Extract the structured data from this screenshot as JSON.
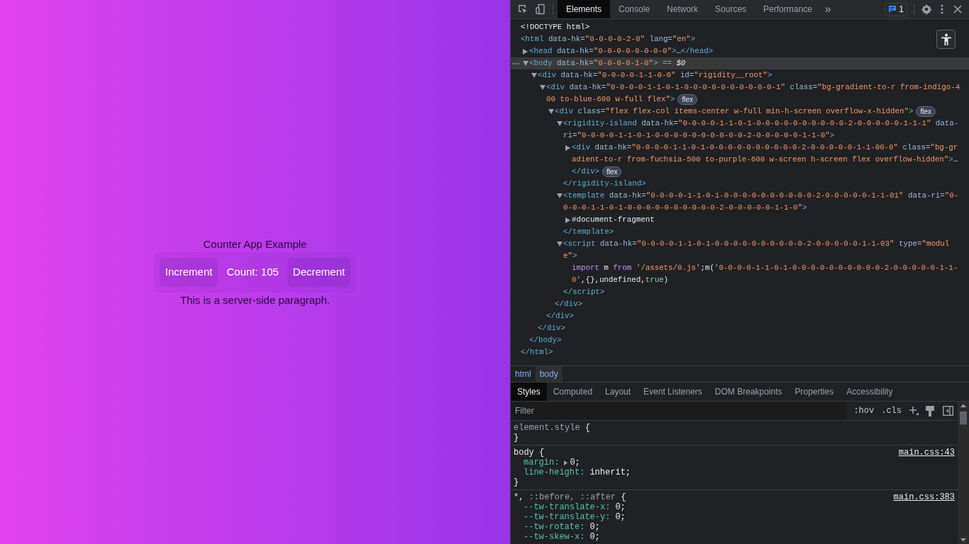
{
  "page": {
    "title": "Counter App Example",
    "increment": "Increment",
    "count": "Count: 105",
    "decrement": "Decrement",
    "paragraph": "This is a server-side paragraph."
  },
  "devtools": {
    "tabs": [
      {
        "label": "Elements",
        "selected": true
      },
      {
        "label": "Console",
        "selected": false
      },
      {
        "label": "Network",
        "selected": false
      },
      {
        "label": "Sources",
        "selected": false
      },
      {
        "label": "Performance",
        "selected": false
      }
    ],
    "more": "»",
    "issues": "1",
    "dom": [
      {
        "selected": false,
        "lines": [
          [
            {
              "kind": "text",
              "text": "<!DOCTYPE html>"
            }
          ]
        ]
      },
      {
        "selected": false,
        "lines": [
          [
            {
              "kind": "tag",
              "text": "<html"
            },
            {
              "kind": "attr",
              "text": " data-hk="
            },
            {
              "kind": "val",
              "text": "\"0-0-0-0-2-0\""
            },
            {
              "kind": "attr",
              "text": " lang="
            },
            {
              "kind": "val",
              "text": "\"en\""
            },
            {
              "kind": "tag",
              "text": ">"
            }
          ]
        ],
        "close": [
          [
            {
              "kind": "tag",
              "text": "</html>"
            }
          ]
        ],
        "children": [
          {
            "selected": false,
            "expanded": false,
            "lines": [
              [
                {
                  "kind": "tag",
                  "text": "<head"
                },
                {
                  "kind": "attr",
                  "text": " data-hk="
                },
                {
                  "kind": "val",
                  "text": "\"0-0-0-0-0-0-0-0\""
                },
                {
                  "kind": "tag",
                  "text": ">"
                },
                {
                  "kind": "text",
                  "text": "…"
                },
                {
                  "kind": "tag",
                  "text": "</head>"
                }
              ]
            ]
          },
          {
            "selected": true,
            "expanded": true,
            "lines": [
              [
                {
                  "kind": "tag",
                  "text": "<body"
                },
                {
                  "kind": "attr",
                  "text": " data-hk="
                },
                {
                  "kind": "val",
                  "text": "\"0-0-0-0-1-0\""
                },
                {
                  "kind": "tag",
                  "text": ">"
                },
                {
                  "kind": "dim",
                  "text": " == "
                },
                {
                  "kind": "ref",
                  "text": "$0"
                }
              ]
            ],
            "close": [
              [
                {
                  "kind": "tag",
                  "text": "</body>"
                }
              ]
            ],
            "children": [
              {
                "selected": false,
                "expanded": true,
                "lines": [
                  [
                    {
                      "kind": "tag",
                      "text": "<div"
                    },
                    {
                      "kind": "attr",
                      "text": " data-hk="
                    },
                    {
                      "kind": "val",
                      "text": "\"0-0-0-0-1-1-0-0\""
                    },
                    {
                      "kind": "attr",
                      "text": " id="
                    },
                    {
                      "kind": "val",
                      "text": "\"rigidity__root\""
                    },
                    {
                      "kind": "tag",
                      "text": ">"
                    }
                  ]
                ],
                "close": [
                  [
                    {
                      "kind": "tag",
                      "text": "</div>"
                    }
                  ]
                ],
                "children": [
                  {
                    "selected": false,
                    "expanded": true,
                    "lines": [
                      [
                        {
                          "kind": "tag",
                          "text": "<div"
                        },
                        {
                          "kind": "attr",
                          "text": " data-hk="
                        },
                        {
                          "kind": "val",
                          "text": "\"0-0-0-0-1-1-0-1-0-0-0-0-0-0-0-0-0-0-1\""
                        },
                        {
                          "kind": "attr",
                          "text": " class="
                        },
                        {
                          "kind": "val",
                          "text": "\"bg-gradient-to-r from-indigo-4"
                        }
                      ],
                      [
                        {
                          "kind": "val",
                          "text": "00 to-blue-600 w-full flex\""
                        },
                        {
                          "kind": "tag",
                          "text": ">"
                        },
                        {
                          "kind": "badge",
                          "text": "flex"
                        }
                      ]
                    ],
                    "close": [
                      [
                        {
                          "kind": "tag",
                          "text": "</div>"
                        }
                      ]
                    ],
                    "children": [
                      {
                        "selected": false,
                        "expanded": true,
                        "lines": [
                          [
                            {
                              "kind": "tag",
                              "text": "<div"
                            },
                            {
                              "kind": "attr",
                              "text": " class="
                            },
                            {
                              "kind": "val",
                              "text": "\"flex flex-col items-center w-full min-h-screen overflow-x-hidden\""
                            },
                            {
                              "kind": "tag",
                              "text": ">"
                            },
                            {
                              "kind": "badge",
                              "text": "flex"
                            }
                          ]
                        ],
                        "close": [
                          [
                            {
                              "kind": "tag",
                              "text": "</div>"
                            }
                          ]
                        ],
                        "children": [
                          {
                            "selected": false,
                            "expanded": true,
                            "lines": [
                              [
                                {
                                  "kind": "tag",
                                  "text": "<rigidity-island"
                                },
                                {
                                  "kind": "attr",
                                  "text": " data-hk="
                                },
                                {
                                  "kind": "val",
                                  "text": "\"0-0-0-0-1-1-0-1-0-0-0-0-0-0-0-0-0-0-2-0-0-0-0-0-1-1-1\""
                                },
                                {
                                  "kind": "attr",
                                  "text": " data-"
                                }
                              ],
                              [
                                {
                                  "kind": "attr",
                                  "text": "ri="
                                },
                                {
                                  "kind": "val",
                                  "text": "\"0-0-0-0-1-1-0-1-0-0-0-0-0-0-0-0-0-0-2-0-0-0-0-0-1-1-0\""
                                },
                                {
                                  "kind": "tag",
                                  "text": ">"
                                }
                              ]
                            ],
                            "close": [
                              [
                                {
                                  "kind": "tag",
                                  "text": "</rigidity-island>"
                                }
                              ]
                            ],
                            "children": [
                              {
                                "selected": false,
                                "expanded": false,
                                "lines": [
                                  [
                                    {
                                      "kind": "tag",
                                      "text": "<div"
                                    },
                                    {
                                      "kind": "attr",
                                      "text": " data-hk="
                                    },
                                    {
                                      "kind": "val",
                                      "text": "\"0-0-0-0-1-1-0-1-0-0-0-0-0-0-0-0-0-0-2-0-0-0-0-0-1-1-00-0\""
                                    },
                                    {
                                      "kind": "attr",
                                      "text": " class="
                                    },
                                    {
                                      "kind": "val",
                                      "text": "\"bg-gr"
                                    }
                                  ],
                                  [
                                    {
                                      "kind": "val",
                                      "text": "adient-to-r from-fuchsia-500 to-purple-600 w-screen h-screen flex overflow-hidden\""
                                    },
                                    {
                                      "kind": "tag",
                                      "text": ">"
                                    },
                                    {
                                      "kind": "text",
                                      "text": "…"
                                    }
                                  ]
                                ],
                                "close": [
                                  [
                                    {
                                      "kind": "tag",
                                      "text": "</div>"
                                    },
                                    {
                                      "kind": "badge",
                                      "text": "flex"
                                    }
                                  ]
                                ]
                              }
                            ]
                          },
                          {
                            "selected": false,
                            "expanded": true,
                            "lines": [
                              [
                                {
                                  "kind": "tag",
                                  "text": "<template"
                                },
                                {
                                  "kind": "attr",
                                  "text": " data-hk="
                                },
                                {
                                  "kind": "val",
                                  "text": "\"0-0-0-0-1-1-0-1-0-0-0-0-0-0-0-0-0-0-2-0-0-0-0-0-1-1-01\""
                                },
                                {
                                  "kind": "attr",
                                  "text": " data-ri="
                                },
                                {
                                  "kind": "val",
                                  "text": "\"0-"
                                }
                              ],
                              [
                                {
                                  "kind": "val",
                                  "text": "0-0-0-1-1-0-1-0-0-0-0-0-0-0-0-0-0-2-0-0-0-0-0-1-1-0\""
                                },
                                {
                                  "kind": "tag",
                                  "text": ">"
                                }
                              ]
                            ],
                            "close": [
                              [
                                {
                                  "kind": "tag",
                                  "text": "</template>"
                                }
                              ]
                            ],
                            "children": [
                              {
                                "selected": false,
                                "expanded": false,
                                "lines": [
                                  [
                                    {
                                      "kind": "text",
                                      "text": "#document-fragment"
                                    }
                                  ]
                                ]
                              }
                            ]
                          },
                          {
                            "selected": false,
                            "expanded": true,
                            "lines": [
                              [
                                {
                                  "kind": "tag",
                                  "text": "<script"
                                },
                                {
                                  "kind": "attr",
                                  "text": " data-hk="
                                },
                                {
                                  "kind": "val",
                                  "text": "\"0-0-0-0-1-1-0-1-0-0-0-0-0-0-0-0-0-0-2-0-0-0-0-0-1-1-03\""
                                },
                                {
                                  "kind": "attr",
                                  "text": " type="
                                },
                                {
                                  "kind": "val",
                                  "text": "\"modul"
                                }
                              ],
                              [
                                {
                                  "kind": "val",
                                  "text": "e\""
                                },
                                {
                                  "kind": "tag",
                                  "text": ">"
                                }
                              ]
                            ],
                            "close": [
                              [
                                {
                                  "kind": "tag",
                                  "text": "</script>"
                                }
                              ]
                            ],
                            "children": [
                              {
                                "selected": false,
                                "lines": [
                                  [
                                    {
                                      "kind": "kw",
                                      "text": "import"
                                    },
                                    {
                                      "kind": "text",
                                      "text": " m "
                                    },
                                    {
                                      "kind": "kw",
                                      "text": "from"
                                    },
                                    {
                                      "kind": "val",
                                      "text": " '/assets/0.js'"
                                    },
                                    {
                                      "kind": "text",
                                      "text": ";m("
                                    },
                                    {
                                      "kind": "val",
                                      "text": "'0-0-0-0-1-1-0-1-0-0-0-0-0-0-0-0-0-0-2-0-0-0-0-0-1-1-"
                                    }
                                  ],
                                  [
                                    {
                                      "kind": "val",
                                      "text": "0'"
                                    },
                                    {
                                      "kind": "text",
                                      "text": ",{},undefined,"
                                    },
                                    {
                                      "kind": "lit",
                                      "text": "true"
                                    },
                                    {
                                      "kind": "text",
                                      "text": ")"
                                    }
                                  ]
                                ]
                              }
                            ]
                          }
                        ]
                      }
                    ]
                  }
                ]
              }
            ]
          }
        ]
      }
    ],
    "breadcrumbs": [
      {
        "label": "html",
        "selected": false
      },
      {
        "label": "body",
        "selected": true
      }
    ],
    "pane_tabs": [
      {
        "label": "Styles",
        "selected": true
      },
      {
        "label": "Computed",
        "selected": false
      },
      {
        "label": "Layout",
        "selected": false
      },
      {
        "label": "Event Listeners",
        "selected": false
      },
      {
        "label": "DOM Breakpoints",
        "selected": false
      },
      {
        "label": "Properties",
        "selected": false
      },
      {
        "label": "Accessibility",
        "selected": false
      }
    ],
    "filter": {
      "placeholder": "Filter"
    },
    "toggles": [
      ":hov",
      ".cls"
    ],
    "rules": [
      {
        "selector": [
          {
            "kind": "dim",
            "text": "element.style"
          },
          {
            "kind": "sel",
            "text": " {"
          }
        ],
        "close": "}"
      },
      {
        "selector": [
          {
            "kind": "sel",
            "text": "body {"
          }
        ],
        "source": "main.css:43",
        "declarations": [
          {
            "name": "margin:",
            "value": "0;",
            "expandable": true
          },
          {
            "name": "line-height:",
            "value": "inherit;"
          }
        ],
        "close": "}"
      },
      {
        "selector": [
          {
            "kind": "sel",
            "text": "*,"
          },
          {
            "kind": "dim",
            "text": " ::before, ::after"
          },
          {
            "kind": "sel",
            "text": " {"
          }
        ],
        "source": "main.css:383",
        "declarations": [
          {
            "name": "--tw-translate-x:",
            "value": "0;"
          },
          {
            "name": "--tw-translate-y:",
            "value": "0;"
          },
          {
            "name": "--tw-rotate:",
            "value": "0;"
          },
          {
            "name": "--tw-skew-x:",
            "value": "0;"
          }
        ]
      }
    ]
  }
}
